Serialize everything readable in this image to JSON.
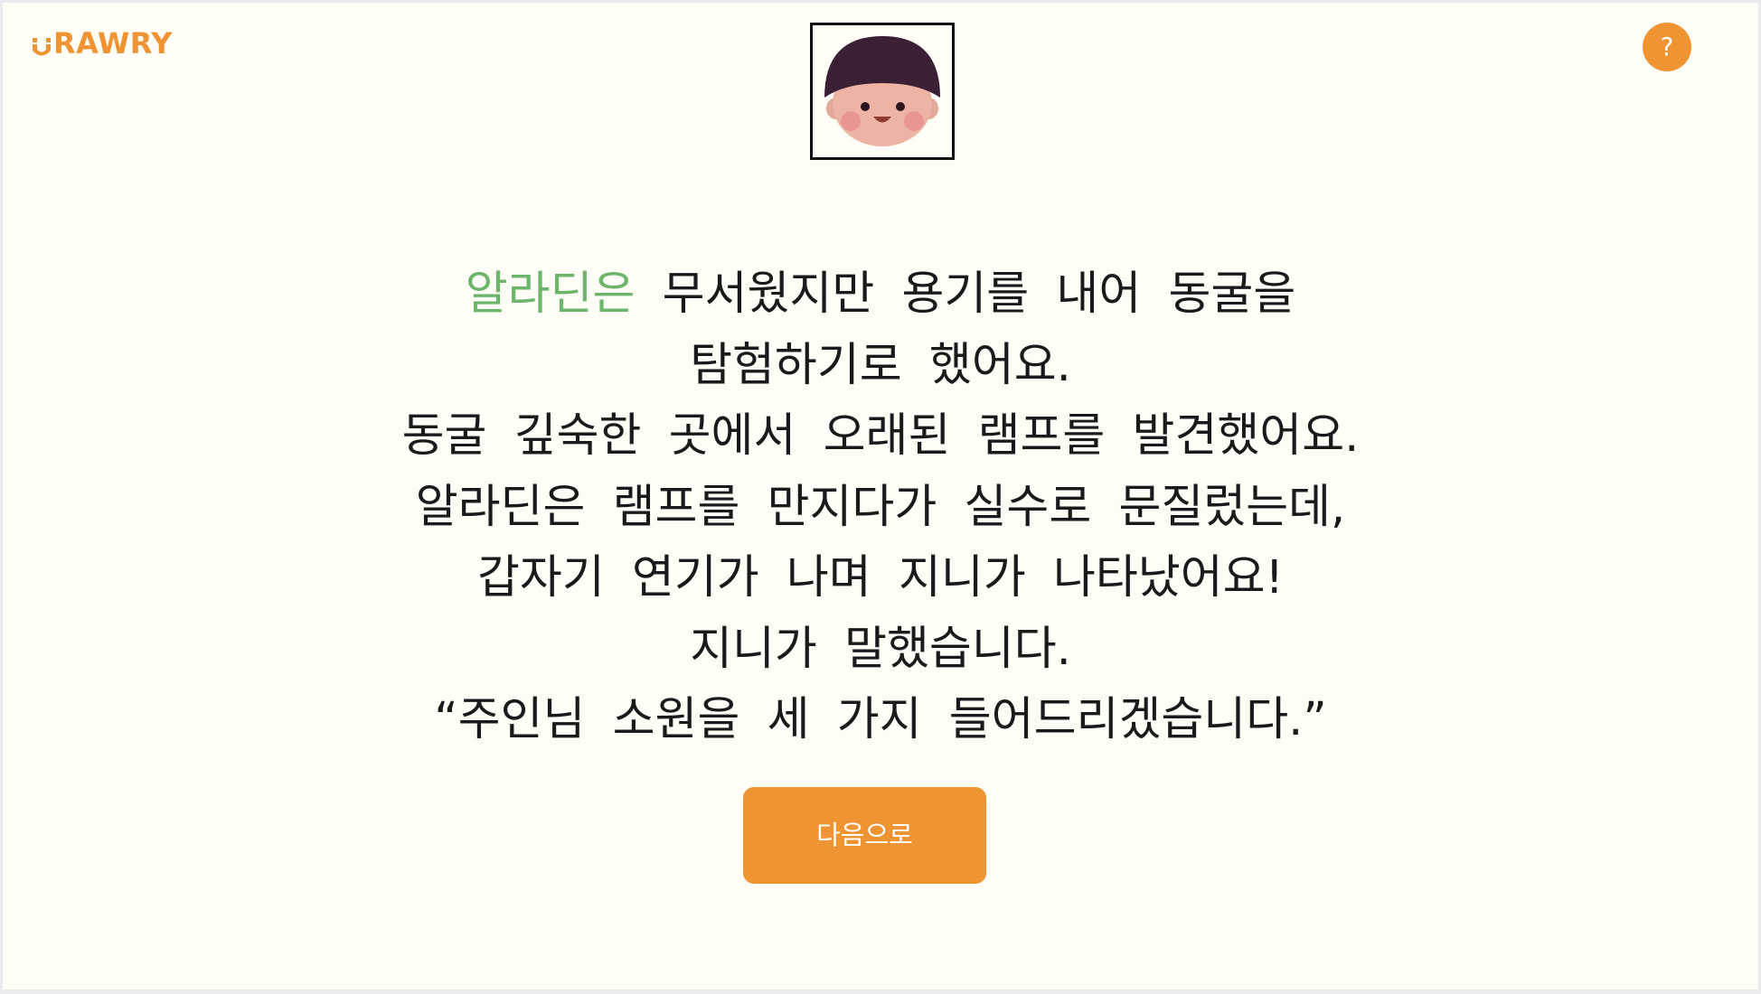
{
  "header": {
    "logo_text": "RAWRY",
    "logo_icon": "smile-u-icon",
    "help_label": "?"
  },
  "avatar": {
    "icon": "child-face-icon"
  },
  "story": {
    "line1_highlight": "알라딘은",
    "line1_rest": "무서웠지만 용기를 내어 동굴을",
    "line2": "탐험하기로 했어요.",
    "line3": "동굴 깊숙한 곳에서 오래된 램프를 발견했어요.",
    "line4": "알라딘은 램프를 만지다가 실수로 문질렀는데,",
    "line5": "갑자기 연기가 나며 지니가 나타났어요!",
    "line6": "지니가 말했습니다.",
    "line7": "“주인님 소원을 세 가지 들어드리겠습니다.”"
  },
  "next_button": {
    "label": "다음으로"
  },
  "colors": {
    "brand_orange": "#ef9433",
    "highlight_green": "#6cb56b",
    "background": "#fefef7"
  }
}
